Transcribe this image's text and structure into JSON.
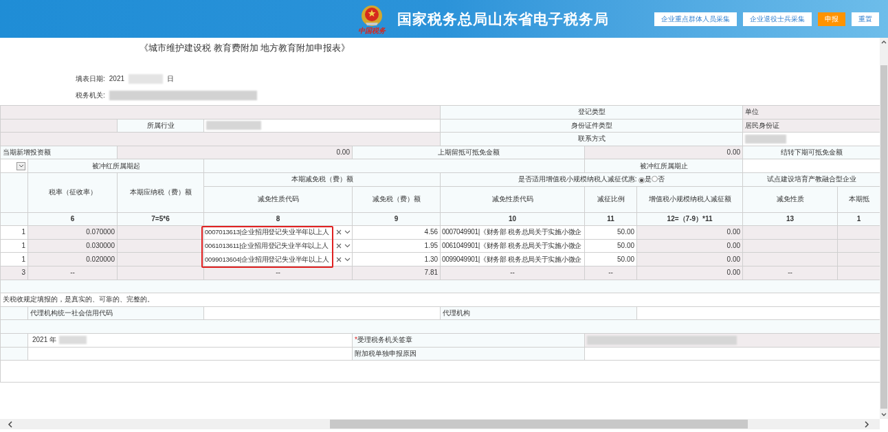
{
  "header": {
    "logo_caption": "中国税务",
    "title": "国家税务总局山东省电子税务局",
    "buttons": [
      {
        "label": "企业重点群体人员采集",
        "kind": "plain"
      },
      {
        "label": "企业退役士兵采集",
        "kind": "plain"
      },
      {
        "label": "申报",
        "kind": "primary"
      },
      {
        "label": "重置",
        "kind": "plain"
      }
    ]
  },
  "form_title": "《城市维护建设税 教育费附加 地方教育附加申报表》",
  "fill_date": {
    "label": "填表日期:",
    "year": "2021",
    "day_suffix": "日"
  },
  "tax_office": {
    "label": "税务机关:"
  },
  "info": {
    "industry_label": "所属行业",
    "registration_type_label": "登记类型",
    "registration_type_value": "单位",
    "id_type_label": "身份证件类型",
    "id_type_value": "居民身份证",
    "contact_label": "联系方式"
  },
  "investment": {
    "new_investment_label": "当期新增投资额",
    "new_investment_value": "0.00",
    "prev_credit_label": "上期留抵可抵免金额",
    "prev_credit_value": "0.00",
    "carry_forward_label": "结转下期可抵免金额"
  },
  "reversal": {
    "start_label": "被冲红所属期起",
    "end_label": "被冲红所属期止"
  },
  "relief_group_label": "本期减免税（费）额",
  "small_scale": {
    "question": "是否适用增值税小规模纳税人减征优惠:",
    "options": [
      {
        "label": "是",
        "selected": true
      },
      {
        "label": "否",
        "selected": false
      }
    ]
  },
  "pilot_group_label": "试点建设培育产教融合型企业",
  "columns": [
    {
      "label": "税率（征收率）",
      "number": "6"
    },
    {
      "label": "本期应纳税（费）额",
      "number": "7=5*6"
    },
    {
      "label": "减免性质代码",
      "number": "8"
    },
    {
      "label": "减免税（费）额",
      "number": "9"
    },
    {
      "label": "减免性质代码",
      "number": "10"
    },
    {
      "label": "减征比例",
      "number": "11"
    },
    {
      "label": "增值税小规模纳税人减征额",
      "number": "12=（7-9）*11"
    },
    {
      "label": "减免性质",
      "number": "13"
    },
    {
      "label": "本期抵",
      "number": "1"
    }
  ],
  "rows": [
    {
      "row_no": "1",
      "rate": "0.070000",
      "relief_code": "0007013613|企业招用登记失业半年以上人",
      "relief_amount": "4.56",
      "vat_relief_code": "0007049901|《财务部 税务总局关于实施小微企",
      "ratio": "50.00",
      "vat_reduction": "0.00"
    },
    {
      "row_no": "1",
      "rate": "0.030000",
      "relief_code": "0061013611|企业招用登记失业半年以上人",
      "relief_amount": "1.95",
      "vat_relief_code": "0061049901|《财务部 税务总局关于实施小微企",
      "ratio": "50.00",
      "vat_reduction": "0.00"
    },
    {
      "row_no": "1",
      "rate": "0.020000",
      "relief_code": "0099013604|企业招用登记失业半年以上人",
      "relief_amount": "1.30",
      "vat_relief_code": "0099049901|《财务部 税务总局关于实施小微企",
      "ratio": "50.00",
      "vat_reduction": "0.00"
    }
  ],
  "total": {
    "row_no": "3",
    "rate": "--",
    "relief_code": "--",
    "relief_amount": "7.81",
    "vat_relief_code": "--",
    "ratio": "--",
    "vat_reduction": "0.00",
    "nature": "--"
  },
  "declaration": "关税收规定填报的，是真实的、可靠的、完整的。",
  "agent": {
    "credit_code_label": "代理机构统一社会信用代码",
    "agency_label": "代理机构"
  },
  "signature": {
    "date_prefix": "2021 年",
    "required_mark": "*",
    "seal_label": "受理税务机关签章",
    "reason_label": "附加税单独申报原因"
  }
}
